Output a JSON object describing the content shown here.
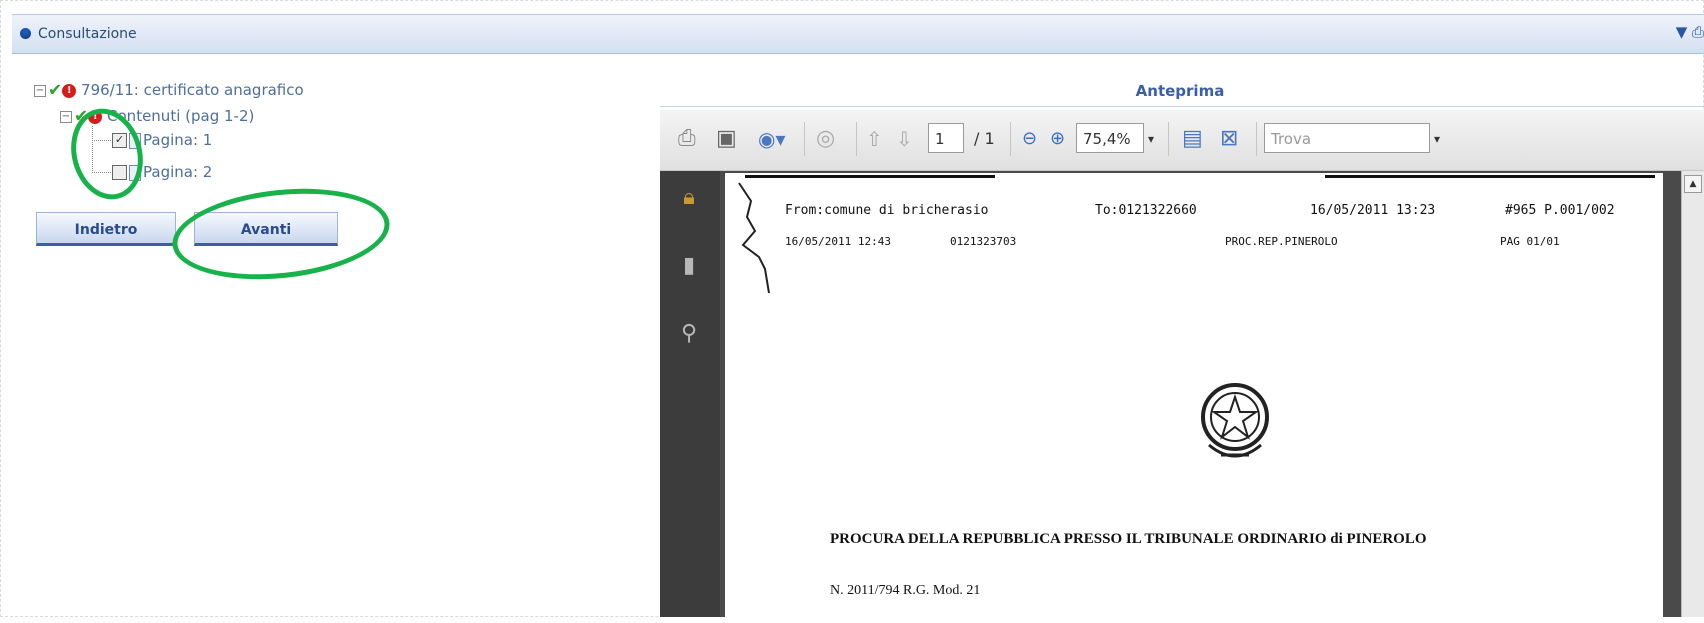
{
  "header": {
    "title": "Consultazione",
    "tools": "▼ ⎙"
  },
  "tree": {
    "root": {
      "label": "796/11: certificato anagrafico"
    },
    "contents": {
      "label": "Contenuti (pag 1-2)"
    },
    "pages": [
      {
        "label": "Pagina: 1"
      },
      {
        "label": "Pagina: 2"
      }
    ]
  },
  "buttons": {
    "back": "Indietro",
    "next": "Avanti"
  },
  "preview": {
    "title": "Anteprima",
    "page_current": "1",
    "page_total": "/ 1",
    "zoom": "75,4%",
    "find_placeholder": "Trova"
  },
  "fax": {
    "from": "From:comune di bricherasio",
    "to": "To:0121322660",
    "datetime": "16/05/2011 13:23",
    "code": "#965 P.001/002",
    "line2_date": "16/05/2011 12:43",
    "line2_number": "0121323703",
    "line2_office": "PROC.REP.PINEROLO",
    "line2_page": "PAG 01/01"
  },
  "document": {
    "heading": "PROCURA DELLA REPUBBLICA PRESSO IL TRIBUNALE ORDINARIO di PINEROLO",
    "reference": "N. 2011/794 R.G. Mod. 21"
  },
  "colors": {
    "accent": "#3a5fa8",
    "annotation": "#18b24a",
    "viewer_bg": "#4a4a4a"
  }
}
